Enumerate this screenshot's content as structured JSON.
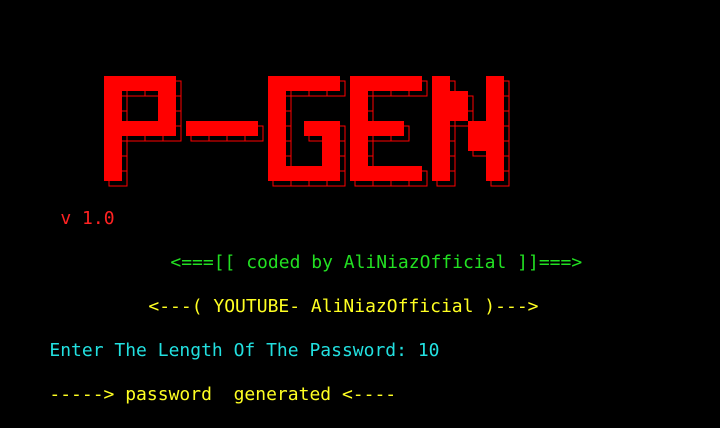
{
  "banner": {
    "text": "P-GEN",
    "color": "#ff0000"
  },
  "version": {
    "text": "v 1.0",
    "color": "#ff2222"
  },
  "credit": {
    "text": "<===[[ coded by AliNiazOfficial ]]===>",
    "color": "#22e022"
  },
  "youtube": {
    "text": "<---( YOUTUBE- AliNiazOfficial )--->",
    "color": "#ffff22"
  },
  "prompt": {
    "label": "Enter The Length Of The Password: ",
    "value": "10",
    "color": "#22e0e0"
  },
  "result": {
    "text": "-----> password  generated <----",
    "color": "#ffff22"
  }
}
